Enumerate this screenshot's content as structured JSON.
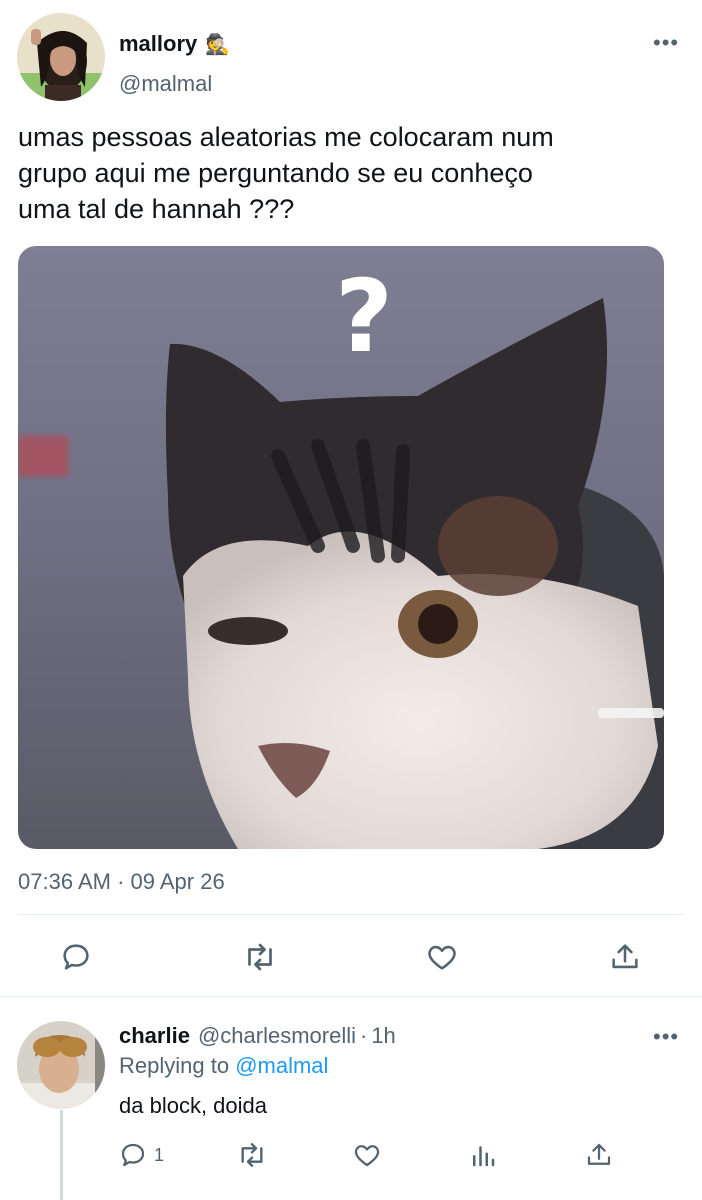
{
  "tweet": {
    "display_name": "mallory",
    "name_emoji": "🕵",
    "handle": "@malmal",
    "text_lines": [
      "umas pessoas aleatorias me colocaram num",
      "grupo aqui me perguntando se eu conheço",
      "uma tal de hannah ???"
    ],
    "media_caption": "?",
    "timestamp": "07:36 AM · 09 Apr 26",
    "more_label": "•••",
    "actions": [
      "reply-icon",
      "retweet-icon",
      "like-icon",
      "share-icon"
    ]
  },
  "reply": {
    "display_name": "charlie",
    "handle": "@charlesmorelli",
    "separator": "·",
    "time": "1h",
    "replying_prefix": "Replying to",
    "replying_to": "@malmal",
    "text": "da block, doida",
    "reply_count": "1",
    "more_label": "•••",
    "actions": [
      "reply-icon",
      "retweet-icon",
      "like-icon",
      "analytics-icon",
      "share-icon"
    ]
  },
  "colors": {
    "accent": "#1d9bf0",
    "muted": "#536471",
    "text": "#0f1419"
  }
}
